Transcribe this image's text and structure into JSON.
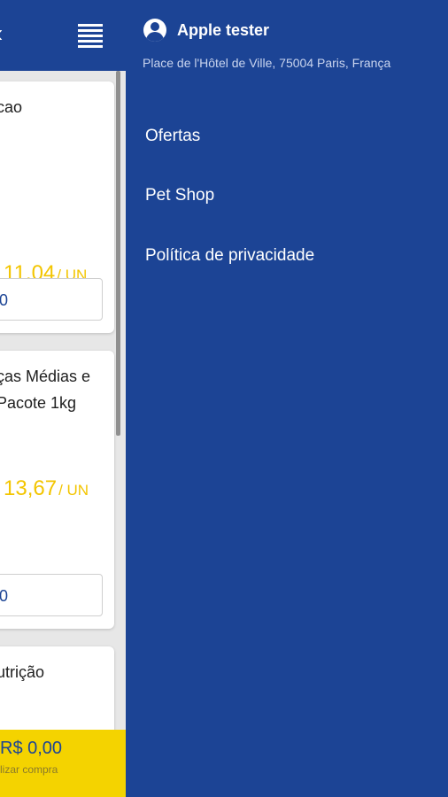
{
  "header": {
    "back_glyph": "‹",
    "menu_icon": "list-icon"
  },
  "products": [
    {
      "name": "cao",
      "price": "11,04",
      "unit": "/ UN",
      "qty": "0"
    },
    {
      "name": "ças Médias e Pacote 1kg",
      "price": "13,67",
      "unit": "/ UN",
      "qty": "0"
    },
    {
      "name": "utrição"
    }
  ],
  "cart": {
    "total": "R$ 0,00",
    "hint": "lizar compra"
  },
  "drawer": {
    "user_name": "Apple tester",
    "address": "Place de l'Hôtel de Ville, 75004 Paris, França",
    "items": [
      {
        "label": "Ofertas"
      },
      {
        "label": "Pet Shop"
      },
      {
        "label": "Política de privacidade"
      }
    ]
  },
  "colors": {
    "primary": "#1c4495",
    "accent": "#f4d300",
    "price": "#f3c500"
  }
}
